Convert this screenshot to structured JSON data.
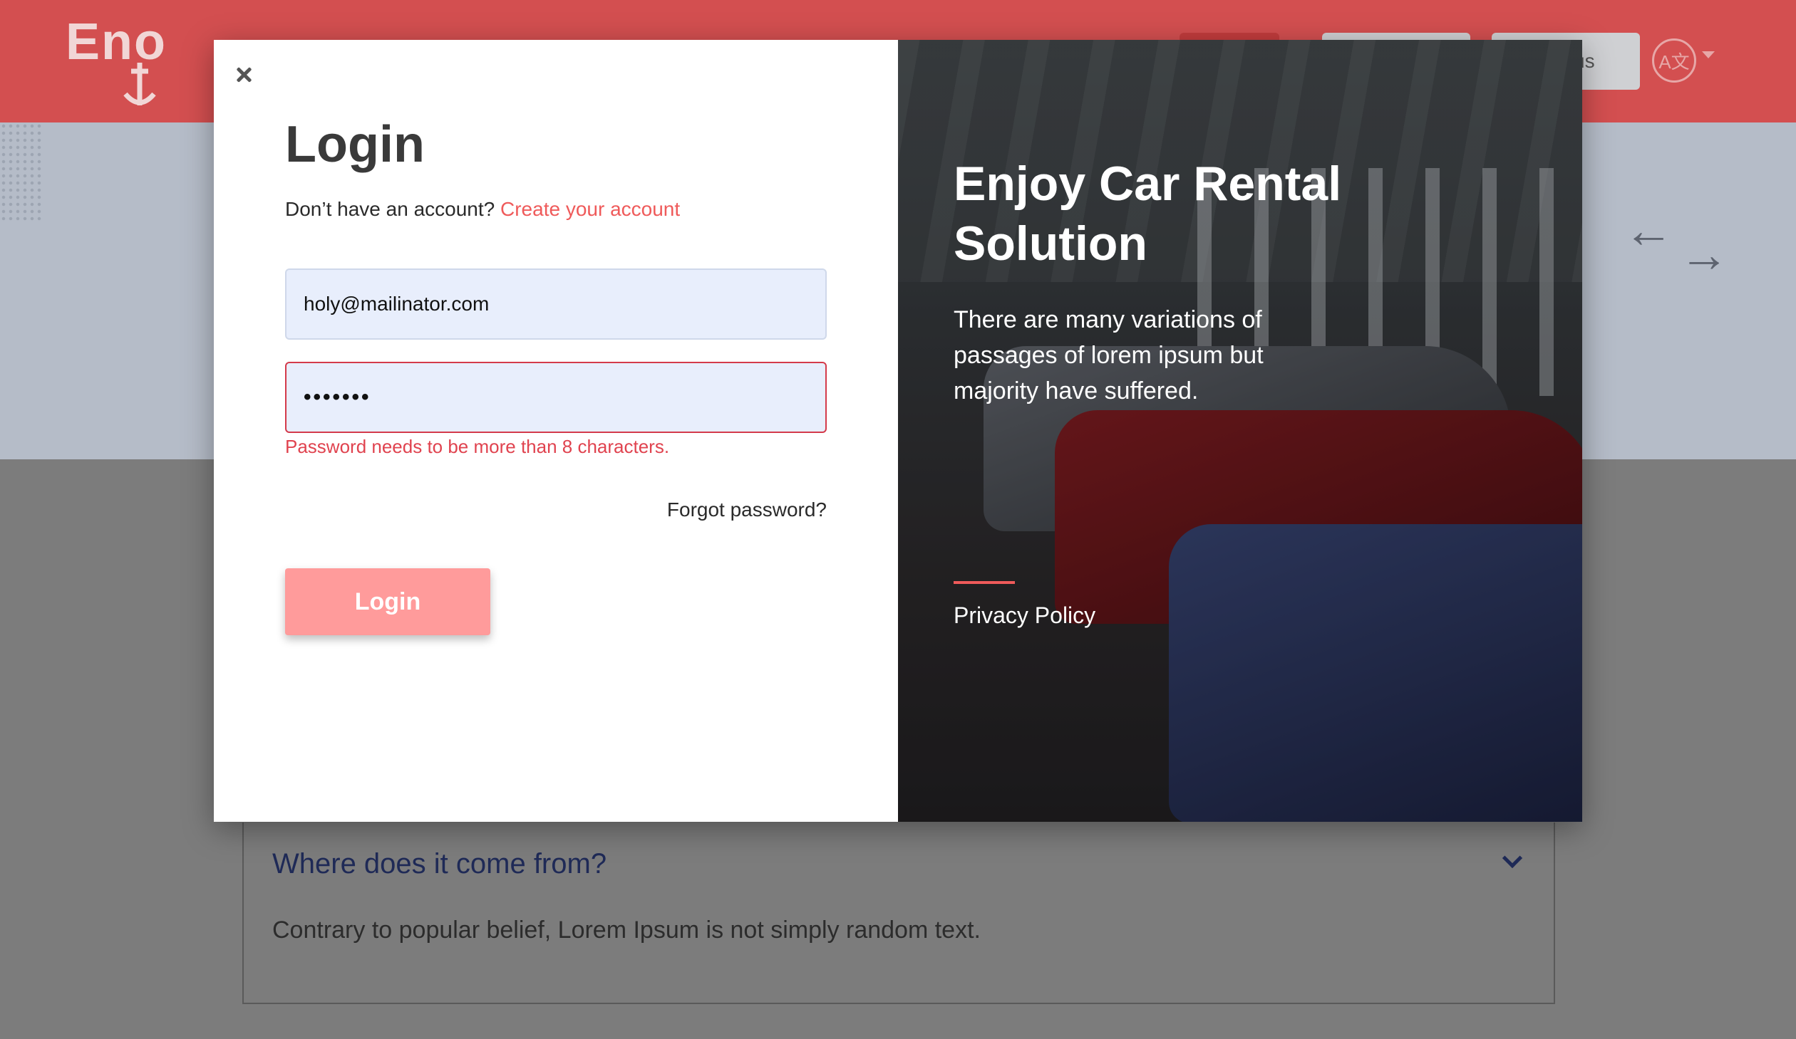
{
  "background": {
    "logo_text": "Eno",
    "nav_button_partial": "us",
    "globe_icon": "globe-translate-icon",
    "faq": {
      "question": "Where does it come from?",
      "answer": "Contrary to popular belief, Lorem Ipsum is not simply random text."
    }
  },
  "modal": {
    "title": "Login",
    "signup_prompt": "Don’t have an account?",
    "signup_link": "Create your account",
    "email_value": "holy@mailinator.com",
    "password_value": "•••••••",
    "password_error": "Password needs to be more than 8 characters.",
    "forgot_password": "Forgot password?",
    "login_button": "Login",
    "promo": {
      "title": "Enjoy Car Rental Solution",
      "text": "There are many variations of passages of lorem ipsum but majority have suffered.",
      "privacy_link": "Privacy Policy"
    }
  },
  "colors": {
    "header_red": "#d34f50",
    "accent": "#ef5a5a",
    "login_button": "#ff9b9b",
    "error": "#e0434f",
    "input_bg": "#e8eefc"
  }
}
